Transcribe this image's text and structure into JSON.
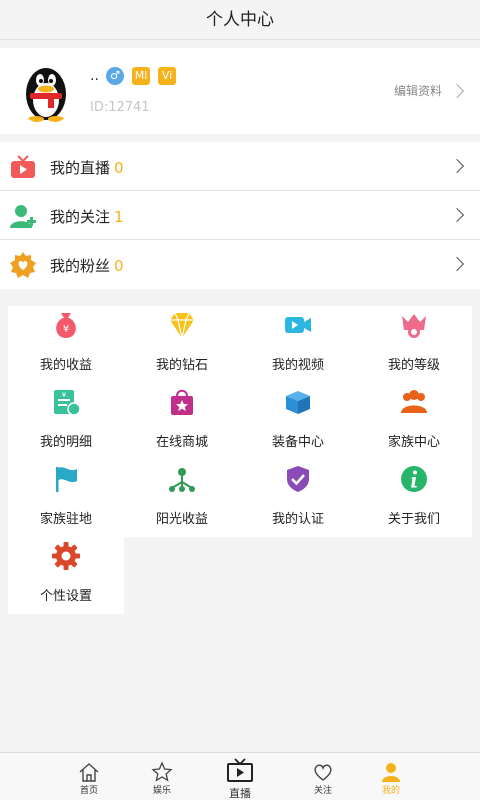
{
  "header": {
    "title": "个人中心"
  },
  "profile": {
    "name": "..",
    "gender_icon": "♂",
    "level_badge_1": "Ml",
    "level_badge_2": "Vi",
    "id_text": "ID:12741",
    "edit_label": "编辑资料"
  },
  "rows": [
    {
      "label": "我的直播",
      "count": "0",
      "icon": "tv-icon",
      "color": "#f25a5a"
    },
    {
      "label": "我的关注",
      "count": "1",
      "icon": "add-user-icon",
      "color": "#3cb878"
    },
    {
      "label": "我的粉丝",
      "count": "0",
      "icon": "heart-badge-icon",
      "color": "#f0a020"
    }
  ],
  "grid": [
    {
      "label": "我的收益",
      "icon": "money-bag-icon",
      "color": "#f25a6a"
    },
    {
      "label": "我的钻石",
      "icon": "diamond-icon",
      "color": "#f6c21b"
    },
    {
      "label": "我的视频",
      "icon": "video-camera-icon",
      "color": "#2bb7e0"
    },
    {
      "label": "我的等级",
      "icon": "crown-icon",
      "color": "#f06a8a"
    },
    {
      "label": "我的明细",
      "icon": "receipt-icon",
      "color": "#37c29a"
    },
    {
      "label": "在线商城",
      "icon": "shopping-bag-icon",
      "color": "#c0308a"
    },
    {
      "label": "装备中心",
      "icon": "box-icon",
      "color": "#2a8fd6"
    },
    {
      "label": "家族中心",
      "icon": "family-icon",
      "color": "#e8621a"
    },
    {
      "label": "家族驻地",
      "icon": "flag-icon",
      "color": "#2aa8c8"
    },
    {
      "label": "阳光收益",
      "icon": "network-icon",
      "color": "#2e9a55"
    },
    {
      "label": "我的认证",
      "icon": "shield-check-icon",
      "color": "#8a4ab8"
    },
    {
      "label": "关于我们",
      "icon": "info-icon",
      "color": "#27b56a"
    },
    {
      "label": "个性设置",
      "icon": "gear-icon",
      "color": "#d9482a"
    }
  ],
  "tabs": [
    {
      "label": "首页",
      "icon": "home-icon"
    },
    {
      "label": "娱乐",
      "icon": "star-icon"
    },
    {
      "label": "直播",
      "icon": "tv-play-icon"
    },
    {
      "label": "关注",
      "icon": "heart-icon"
    },
    {
      "label": "我的",
      "icon": "person-icon",
      "active_color": "#f6b21b"
    }
  ]
}
